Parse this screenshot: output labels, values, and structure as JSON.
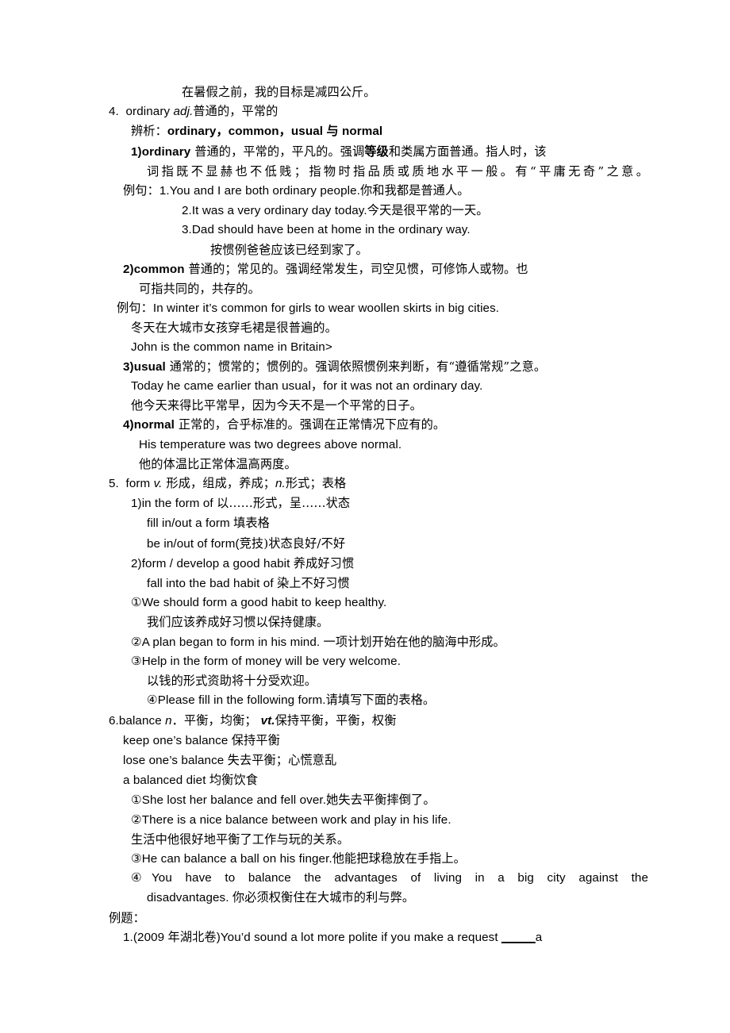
{
  "document": {
    "type": "english-vocabulary-study-notes",
    "lines": [
      {
        "id": "l1",
        "text": "在暑假之前，我的目标是减四公斤。"
      },
      {
        "id": "l2",
        "text": "4.  ordinary "
      },
      {
        "id": "l2b",
        "text": "adj."
      },
      {
        "id": "l2c",
        "text": "普通的，平常的"
      },
      {
        "id": "l3a",
        "text": "辨析："
      },
      {
        "id": "l3b",
        "text": "ordinary，common，usual 与 normal"
      },
      {
        "id": "l4a",
        "text": "1)ordinary"
      },
      {
        "id": "l4b",
        "text": " 普通的，平常的，平凡的。强调"
      },
      {
        "id": "l4c",
        "text": "等级"
      },
      {
        "id": "l4d",
        "text": "和类属方面普通。指人时，该"
      },
      {
        "id": "l5",
        "text": "词指既不显赫也不低贱；指物时指品质或质地水平一般。有“平庸无奇”之意。"
      },
      {
        "id": "l6a",
        "text": "例句："
      },
      {
        "id": "l6b",
        "text": "1.You and I are both ordinary people."
      },
      {
        "id": "l6c",
        "text": "你和我都是普通人。"
      },
      {
        "id": "l7a",
        "text": "2.It was a very ordinary day today."
      },
      {
        "id": "l7b",
        "text": "今天是很平常的一天。"
      },
      {
        "id": "l8",
        "text": "3.Dad should have been at home in the ordinary way."
      },
      {
        "id": "l9",
        "text": "按惯例爸爸应该已经到家了。"
      },
      {
        "id": "l10a",
        "text": "2)common"
      },
      {
        "id": "l10b",
        "text": " 普通的；常见的。强调经常发生，司空见惯，可修饰人或物。也"
      },
      {
        "id": "l11",
        "text": "可指共同的，共存的。"
      },
      {
        "id": "l12a",
        "text": "例句："
      },
      {
        "id": "l12b",
        "text": "In winter it’s common for girls to wear woollen skirts in big cities."
      },
      {
        "id": "l13",
        "text": "冬天在大城市女孩穿毛裙是很普遍的。"
      },
      {
        "id": "l14",
        "text": "John is the common name in Britain>"
      },
      {
        "id": "l15a",
        "text": "3)usual"
      },
      {
        "id": "l15b",
        "text": " 通常的；惯常的；惯例的。强调依照惯例来判断，有“遵循常规”之意。"
      },
      {
        "id": "l16",
        "text": "Today he came earlier than usual，for it was not an ordinary day."
      },
      {
        "id": "l17",
        "text": "他今天来得比平常早，因为今天不是一个平常的日子。"
      },
      {
        "id": "l18a",
        "text": "4)normal"
      },
      {
        "id": "l18b",
        "text": " 正常的，合乎标准的。强调在正常情况下应有的。"
      },
      {
        "id": "l19",
        "text": "His temperature was two degrees above normal."
      },
      {
        "id": "l20",
        "text": "他的体温比正常体温高两度。"
      },
      {
        "id": "l21a",
        "text": "5.  form "
      },
      {
        "id": "l21b",
        "text": "v."
      },
      {
        "id": "l21c",
        "text": " 形成，组成，养成；"
      },
      {
        "id": "l21d",
        "text": "n."
      },
      {
        "id": "l21e",
        "text": "形式；表格"
      },
      {
        "id": "l22a",
        "text": "1)in the form of "
      },
      {
        "id": "l22b",
        "text": "以……形式，呈……状态"
      },
      {
        "id": "l23a",
        "text": "fill in/out a form "
      },
      {
        "id": "l23b",
        "text": "填表格"
      },
      {
        "id": "l24a",
        "text": "be in/out of form("
      },
      {
        "id": "l24b",
        "text": "竞技"
      },
      {
        "id": "l24c",
        "text": ")状态良好/不好"
      },
      {
        "id": "l25a",
        "text": "2)form / develop a good habit "
      },
      {
        "id": "l25b",
        "text": "养成好习惯"
      },
      {
        "id": "l26a",
        "text": "fall into the bad habit of "
      },
      {
        "id": "l26b",
        "text": "染上不好习惯"
      },
      {
        "id": "l27",
        "text": "①We should form a good habit to keep healthy."
      },
      {
        "id": "l28",
        "text": "我们应该养成好习惯以保持健康。"
      },
      {
        "id": "l29a",
        "text": "②A plan began to form in his mind. "
      },
      {
        "id": "l29b",
        "text": "一项计划开始在他的脑海中形成。"
      },
      {
        "id": "l30",
        "text": "③Help in the form of money will be very welcome."
      },
      {
        "id": "l31",
        "text": "以钱的形式资助将十分受欢迎。"
      },
      {
        "id": "l32a",
        "text": "④Please fill in the following form."
      },
      {
        "id": "l32b",
        "text": "请填写下面的表格。"
      },
      {
        "id": "l33a",
        "text": "6.balance "
      },
      {
        "id": "l33b",
        "text": "n"
      },
      {
        "id": "l33c",
        "text": "．平衡，均衡； "
      },
      {
        "id": "l33d",
        "text": "vt."
      },
      {
        "id": "l33e",
        "text": "保持平衡，平衡，权衡"
      },
      {
        "id": "l34a",
        "text": "keep one’s balance "
      },
      {
        "id": "l34b",
        "text": "保持平衡"
      },
      {
        "id": "l35a",
        "text": "lose one’s balance "
      },
      {
        "id": "l35b",
        "text": "失去平衡；心慌意乱"
      },
      {
        "id": "l36a",
        "text": "a balanced diet "
      },
      {
        "id": "l36b",
        "text": "均衡饮食"
      },
      {
        "id": "l37a",
        "text": "①She lost her balance and fell over."
      },
      {
        "id": "l37b",
        "text": "她失去平衡摔倒了。"
      },
      {
        "id": "l38",
        "text": "②There is a nice balance between work and play in his life."
      },
      {
        "id": "l39",
        "text": "生活中他很好地平衡了工作与玩的关系。"
      },
      {
        "id": "l40a",
        "text": "③He can balance a ball on his finger."
      },
      {
        "id": "l40b",
        "text": "他能把球稳放在手指上。"
      },
      {
        "id": "l41",
        "text": "④You have to balance the advantages of living in a big city against the"
      },
      {
        "id": "l42a",
        "text": "disadvantages. "
      },
      {
        "id": "l42b",
        "text": "你必须权衡住在大城市的利与弊。"
      },
      {
        "id": "l43",
        "text": "例题："
      },
      {
        "id": "l44a",
        "text": "1.(2009 "
      },
      {
        "id": "l44b",
        "text": "年湖北卷"
      },
      {
        "id": "l44c",
        "text": ")You’d sound a lot more polite if you make a request "
      },
      {
        "id": "l44d",
        "text": "_____"
      },
      {
        "id": "l44e",
        "text": "a"
      }
    ]
  }
}
